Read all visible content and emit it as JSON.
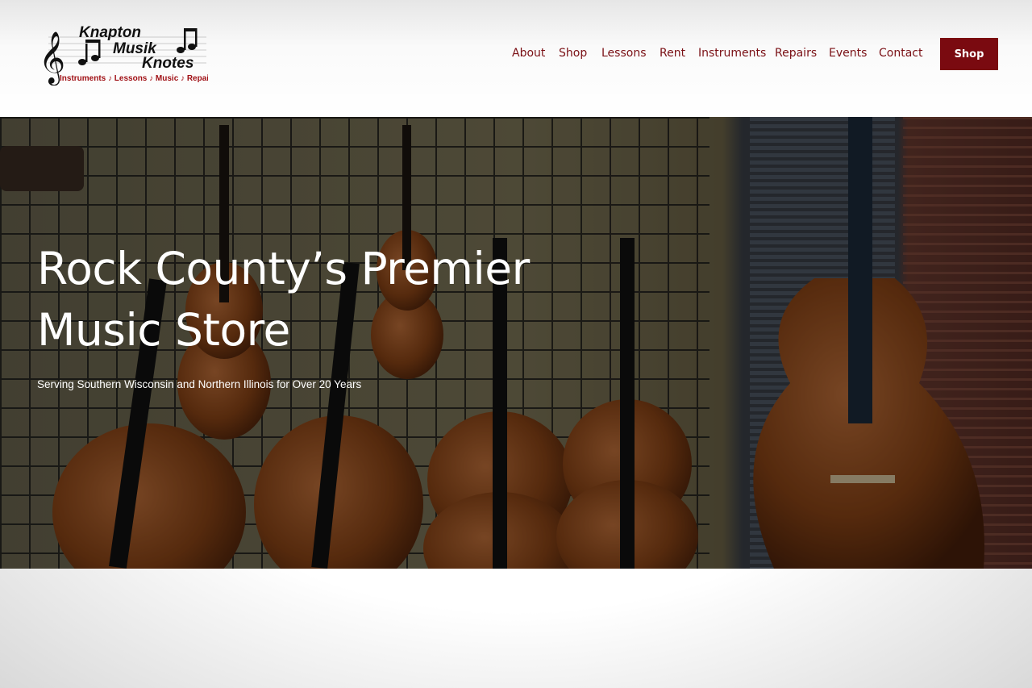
{
  "logo": {
    "line1": "Knapton",
    "line2": "Musik",
    "line3": "Knotes",
    "tagline": "Instruments ♪ Lessons ♪ Music ♪ Repairs"
  },
  "nav": {
    "items": [
      {
        "label": "About"
      },
      {
        "label": "Shop"
      },
      {
        "label": "Lessons"
      },
      {
        "label": "Rent"
      },
      {
        "label": "Instruments"
      },
      {
        "label": "Repairs"
      },
      {
        "label": "Events"
      },
      {
        "label": "Contact"
      }
    ],
    "cta_label": "Shop"
  },
  "hero": {
    "title": "Rock County’s Premier Music Store",
    "subtitle": "Serving Southern Wisconsin and Northern Illinois for Over 20 Years"
  },
  "colors": {
    "brand": "#7a0a10",
    "nav_text": "#7a1015"
  }
}
